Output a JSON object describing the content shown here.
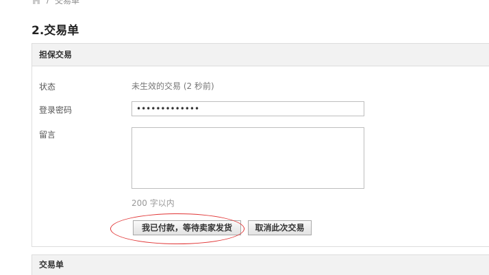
{
  "breadcrumb": {
    "home_icon": "home-icon",
    "separator": "/",
    "current": "交易单"
  },
  "page_title": "2.交易单",
  "escrow_panel": {
    "header": "担保交易",
    "status_label": "状态",
    "status_value": "未生效的交易 (2 秒前)",
    "password_label": "登录密码",
    "password_value": "•••••••••••••",
    "message_label": "留言",
    "message_value": "",
    "char_limit": "200 字以内",
    "pay_button": "我已付款，等待卖家发货",
    "cancel_button": "取消此次交易",
    "highlight_color": "#e03030"
  },
  "next_panel": {
    "header": "交易单"
  }
}
